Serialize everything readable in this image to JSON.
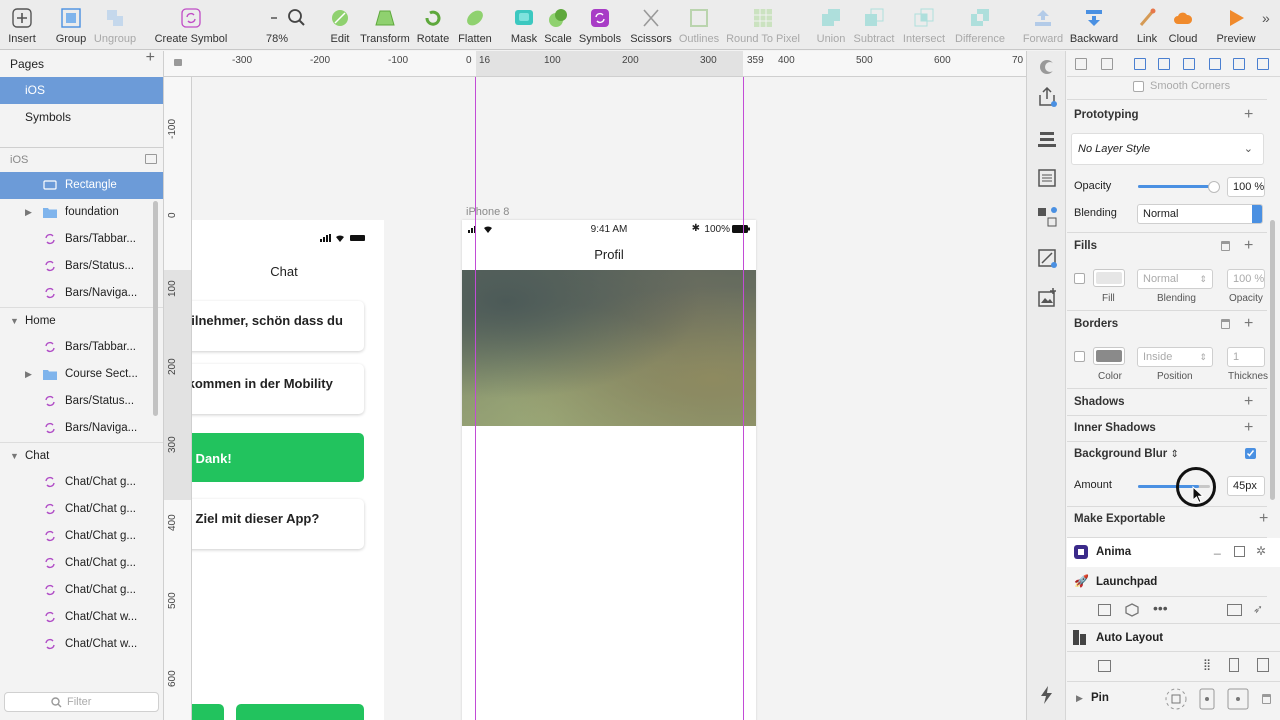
{
  "toolbar": {
    "insert": "Insert",
    "group": "Group",
    "ungroup": "Ungroup",
    "create_symbol": "Create Symbol",
    "zoom": "78%",
    "edit": "Edit",
    "transform": "Transform",
    "rotate": "Rotate",
    "flatten": "Flatten",
    "mask": "Mask",
    "scale": "Scale",
    "symbols": "Symbols",
    "scissors": "Scissors",
    "outlines": "Outlines",
    "round": "Round To Pixel",
    "union": "Union",
    "subtract": "Subtract",
    "intersect": "Intersect",
    "difference": "Difference",
    "forward": "Forward",
    "backward": "Backward",
    "link": "Link",
    "cloud": "Cloud",
    "preview": "Preview"
  },
  "pages": {
    "title": "Pages",
    "items": [
      "iOS",
      "Symbols"
    ],
    "selected": "iOS"
  },
  "layers": {
    "header": "iOS",
    "items": [
      {
        "label": "Rectangle",
        "type": "rect",
        "selected": true
      },
      {
        "label": "foundation",
        "type": "folder"
      },
      {
        "label": "Bars/Tabbar...",
        "type": "symbol"
      },
      {
        "label": "Bars/Status...",
        "type": "symbol"
      },
      {
        "label": "Bars/Naviga...",
        "type": "symbol"
      },
      {
        "label": "Home",
        "type": "group"
      },
      {
        "label": "Bars/Tabbar...",
        "type": "symbol"
      },
      {
        "label": "Course Sect...",
        "type": "folder"
      },
      {
        "label": "Bars/Status...",
        "type": "symbol"
      },
      {
        "label": "Bars/Naviga...",
        "type": "symbol"
      },
      {
        "label": "Chat",
        "type": "group"
      },
      {
        "label": "Chat/Chat g...",
        "type": "symbol"
      },
      {
        "label": "Chat/Chat g...",
        "type": "symbol"
      },
      {
        "label": "Chat/Chat g...",
        "type": "symbol"
      },
      {
        "label": "Chat/Chat g...",
        "type": "symbol"
      },
      {
        "label": "Chat/Chat g...",
        "type": "symbol"
      },
      {
        "label": "Chat/Chat w...",
        "type": "symbol"
      },
      {
        "label": "Chat/Chat w...",
        "type": "symbol"
      }
    ],
    "filter_placeholder": "Filter"
  },
  "ruler": {
    "h_ticks": [
      "-300",
      "-200",
      "-100",
      "0",
      "16",
      "100",
      "200",
      "300",
      "359",
      "400",
      "500",
      "600",
      "70"
    ],
    "v_ticks": [
      "-100",
      "0",
      "100",
      "200",
      "300",
      "400",
      "500",
      "600"
    ]
  },
  "canvas": {
    "chat": {
      "title": "Chat",
      "bubbles": [
        "eilnehmer, schön dass du",
        "lkommen in der Mobility",
        "n Dank!",
        "n Ziel mit dieser App?"
      ]
    },
    "iphone": {
      "label": "iPhone 8",
      "time": "9:41 AM",
      "battery": "100%",
      "title": "Profil"
    }
  },
  "inspector": {
    "smooth_corners": "Smooth Corners",
    "prototyping": "Prototyping",
    "layer_style": "No Layer Style",
    "opacity_label": "Opacity",
    "opacity_value": "100 %",
    "blending_label": "Blending",
    "blending_value": "Normal",
    "fills": {
      "title": "Fills",
      "blending": "Normal",
      "opacity": "100 %",
      "cap_fill": "Fill",
      "cap_blending": "Blending",
      "cap_opacity": "Opacity",
      "swatch_color": "#e6e6e6"
    },
    "borders": {
      "title": "Borders",
      "position": "Inside",
      "thickness": "1",
      "cap_color": "Color",
      "cap_position": "Position",
      "cap_thickness": "Thicknes",
      "swatch_color": "#8a8a8a"
    },
    "shadows": "Shadows",
    "inner_shadows": "Inner Shadows",
    "background_blur": "Background Blur",
    "amount_label": "Amount",
    "amount_value": "45px",
    "amount_level": 0.85,
    "opacity_level": 1.0,
    "make_exportable": "Make Exportable",
    "anima": "Anima",
    "launchpad": "Launchpad",
    "auto_layout": "Auto Layout",
    "pin": "Pin"
  },
  "colors": {
    "selection": "#6c9bd8",
    "guide": "#c24bd6",
    "accent": "#4a90e2",
    "green": "#22c35e"
  }
}
